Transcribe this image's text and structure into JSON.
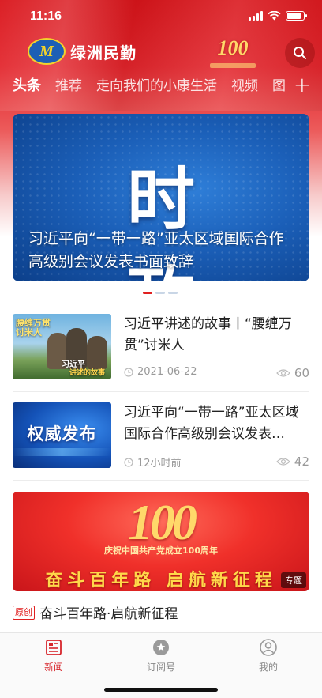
{
  "status_bar": {
    "time": "11:16"
  },
  "brand": {
    "logo_letter": "M",
    "name": "绿洲民勤",
    "badge_number": "100"
  },
  "tabs": [
    {
      "label": "头条",
      "active": true
    },
    {
      "label": "推荐"
    },
    {
      "label": "走向我们的小康生活"
    },
    {
      "label": "视频"
    },
    {
      "label": "图"
    }
  ],
  "tab_add_label": "+",
  "banner": {
    "big_text": "时政",
    "caption": "习近平向“一带一路”亚太区域国际合作高级别会议发表书面致辞",
    "page_count": 3,
    "active_page": 0
  },
  "news": [
    {
      "title": "习近平讲述的故事丨“腰缠万贯”讨米人",
      "time": "2021-06-22",
      "views": "60",
      "thumb": {
        "label_top": "腰缠万贯讨米人",
        "label_bottom": "习近平",
        "label_sub": "讲述的故事"
      }
    },
    {
      "title": "习近平向“一带一路”亚太区域国际合作高级别会议发表…",
      "time": "12小时前",
      "views": "42",
      "thumb": {
        "text": "权威发布"
      }
    }
  ],
  "feature": {
    "number": "100",
    "subtitle": "庆祝中国共产党成立100周年",
    "slogan": "奋斗百年路 启航新征程",
    "tag": "专题",
    "origin_tag": "原创",
    "title": "奋斗百年路·启航新征程"
  },
  "bottom_nav": [
    {
      "label": "新闻",
      "icon": "news-icon",
      "active": true
    },
    {
      "label": "订阅号",
      "icon": "subscribe-icon"
    },
    {
      "label": "我的",
      "icon": "profile-icon"
    }
  ],
  "colors": {
    "brand_red": "#d9141a",
    "active_nav": "#d7262c",
    "banner_blue": "#1b5fb8",
    "meta_gray": "#999999"
  }
}
